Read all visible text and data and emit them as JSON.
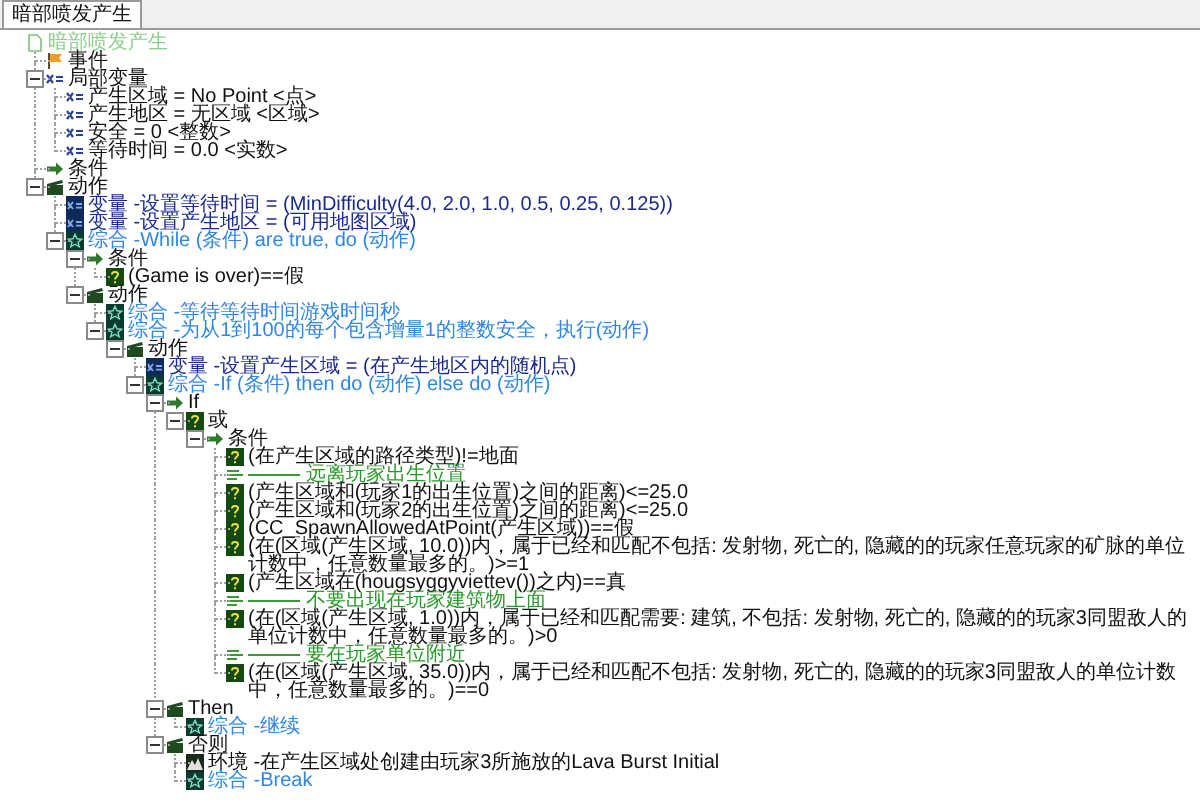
{
  "tab": {
    "label": "暗部喷发产生"
  },
  "tree": {
    "kind": "trigger",
    "label": "暗部喷发产生",
    "children": [
      {
        "kind": "event",
        "label": "事件"
      },
      {
        "kind": "variables",
        "label": "局部变量",
        "expanded": true,
        "children": [
          {
            "kind": "variable",
            "label": "产生区域 = No Point <点>"
          },
          {
            "kind": "variable",
            "label": "产生地区 = 无区域 <区域>"
          },
          {
            "kind": "variable",
            "label": "安全 = 0 <整数>"
          },
          {
            "kind": "variable",
            "label": "等待时间 = 0.0 <实数>"
          }
        ]
      },
      {
        "kind": "conditions",
        "label": "条件"
      },
      {
        "kind": "actions",
        "label": "动作",
        "expanded": true,
        "children": [
          {
            "kind": "set-variable",
            "label": "变量 -设置等待时间 = (MinDifficulty(4.0, 2.0, 1.0, 0.5, 0.25, 0.125))"
          },
          {
            "kind": "set-variable",
            "label": "变量 -设置产生地区 = (可用地图区域)"
          },
          {
            "kind": "composite",
            "label": "综合 -While (条件) are true, do (动作)",
            "expanded": true,
            "children": [
              {
                "kind": "conditions",
                "label": "条件",
                "expanded": true,
                "children": [
                  {
                    "kind": "condition",
                    "label": "(Game is over)==假"
                  }
                ]
              },
              {
                "kind": "actions",
                "label": "动作",
                "expanded": true,
                "children": [
                  {
                    "kind": "composite",
                    "label": "综合 -等待等待时间游戏时间秒"
                  },
                  {
                    "kind": "composite",
                    "label": "综合 -为从1到100的每个包含增量1的整数安全，执行(动作)",
                    "expanded": true,
                    "children": [
                      {
                        "kind": "actions",
                        "label": "动作",
                        "expanded": true,
                        "children": [
                          {
                            "kind": "set-variable",
                            "label": "变量 -设置产生区域 = (在产生地区内的随机点)"
                          },
                          {
                            "kind": "composite",
                            "label": "综合 -If (条件) then do (动作) else do (动作)",
                            "expanded": true,
                            "children": [
                              {
                                "kind": "conditions",
                                "label": "If",
                                "expanded": true,
                                "children": [
                                  {
                                    "kind": "condition",
                                    "label": "或",
                                    "expanded": true,
                                    "children": [
                                      {
                                        "kind": "conditions",
                                        "label": "条件",
                                        "expanded": true,
                                        "children": [
                                          {
                                            "kind": "condition",
                                            "label": "(在产生区域的路径类型)!=地面"
                                          },
                                          {
                                            "kind": "comment",
                                            "label": "远离玩家出生位置"
                                          },
                                          {
                                            "kind": "condition",
                                            "label": "(产生区域和(玩家1的出生位置)之间的距离)<=25.0"
                                          },
                                          {
                                            "kind": "condition",
                                            "label": "(产生区域和(玩家2的出生位置)之间的距离)<=25.0"
                                          },
                                          {
                                            "kind": "condition",
                                            "label": "(CC_SpawnAllowedAtPoint(产生区域))==假"
                                          },
                                          {
                                            "kind": "condition",
                                            "label": "(在(区域(产生区域, 10.0))内，属于已经和匹配不包括: 发射物, 死亡的, 隐藏的的玩家任意玩家的矿脉的单位计数中，任意数量最多的。)>=1"
                                          },
                                          {
                                            "kind": "condition",
                                            "label": "(产生区域在(hougsyggyviettev())之内)==真"
                                          },
                                          {
                                            "kind": "comment",
                                            "label": "不要出现在玩家建筑物上面"
                                          },
                                          {
                                            "kind": "condition",
                                            "label": "(在(区域(产生区域, 1.0))内，属于已经和匹配需要: 建筑, 不包括: 发射物, 死亡的, 隐藏的的玩家3同盟敌人的单位计数中，任意数量最多的。)>0"
                                          },
                                          {
                                            "kind": "comment",
                                            "label": "要在玩家单位附近"
                                          },
                                          {
                                            "kind": "condition",
                                            "label": "(在(区域(产生区域, 35.0))内，属于已经和匹配不包括: 发射物, 死亡的, 隐藏的的玩家3同盟敌人的单位计数中，任意数量最多的。)==0"
                                          }
                                        ]
                                      }
                                    ]
                                  }
                                ]
                              },
                              {
                                "kind": "actions",
                                "label": "Then",
                                "expanded": true,
                                "children": [
                                  {
                                    "kind": "composite",
                                    "label": "综合 -继续"
                                  }
                                ]
                              },
                              {
                                "kind": "actions",
                                "label": "否则",
                                "expanded": true,
                                "children": [
                                  {
                                    "kind": "environment",
                                    "label": "环境 -在产生区域处创建由玩家3所施放的Lava Burst Initial"
                                  },
                                  {
                                    "kind": "composite",
                                    "label": "综合 -Break"
                                  }
                                ]
                              }
                            ]
                          }
                        ]
                      }
                    ]
                  }
                ]
              }
            ]
          }
        ]
      }
    ]
  }
}
